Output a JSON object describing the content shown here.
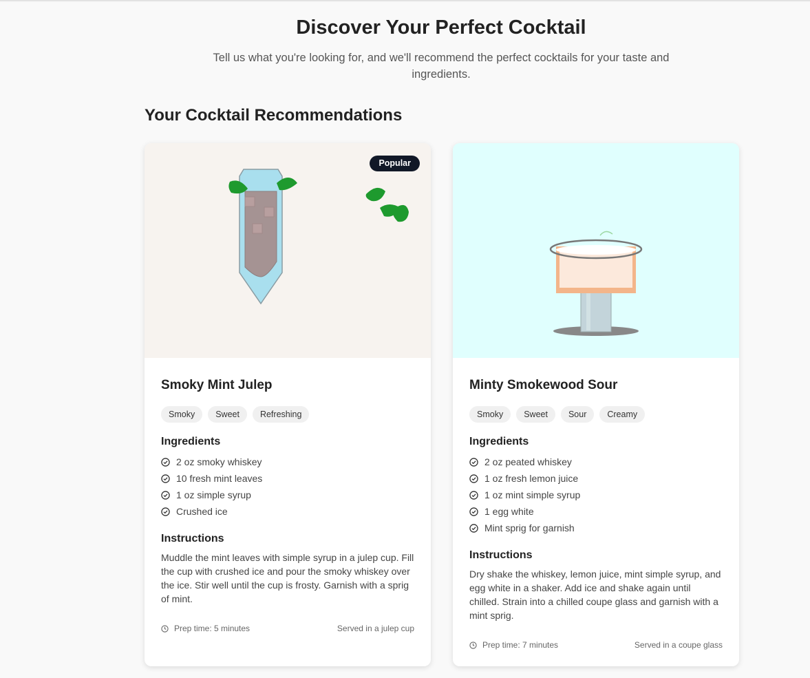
{
  "header": {
    "title": "Discover Your Perfect Cocktail",
    "subtitle": "Tell us what you're looking for, and we'll recommend the perfect cocktails for your taste and ingredients."
  },
  "section_title": "Your Cocktail Recommendations",
  "cards": [
    {
      "badge": "Popular",
      "title": "Smoky Mint Julep",
      "tags": [
        "Smoky",
        "Sweet",
        "Refreshing"
      ],
      "ingredients_heading": "Ingredients",
      "ingredients": [
        "2 oz smoky whiskey",
        "10 fresh mint leaves",
        "1 oz simple syrup",
        "Crushed ice"
      ],
      "instructions_heading": "Instructions",
      "instructions": "Muddle the mint leaves with simple syrup in a julep cup. Fill the cup with crushed ice and pour the smoky whiskey over the ice. Stir well until the cup is frosty. Garnish with a sprig of mint.",
      "prep_time": "Prep time: 5 minutes",
      "served_in": "Served in a julep cup",
      "image_bg": "#f7f3ef"
    },
    {
      "title": "Minty Smokewood Sour",
      "tags": [
        "Smoky",
        "Sweet",
        "Sour",
        "Creamy"
      ],
      "ingredients_heading": "Ingredients",
      "ingredients": [
        "2 oz peated whiskey",
        "1 oz fresh lemon juice",
        "1 oz mint simple syrup",
        "1 egg white",
        "Mint sprig for garnish"
      ],
      "instructions_heading": "Instructions",
      "instructions": "Dry shake the whiskey, lemon juice, mint simple syrup, and egg white in a shaker. Add ice and shake again until chilled. Strain into a chilled coupe glass and garnish with a mint sprig.",
      "prep_time": "Prep time: 7 minutes",
      "served_in": "Served in a coupe glass",
      "image_bg": "#e0fffe"
    }
  ],
  "icons": {
    "check": "check-circle-icon",
    "clock": "clock-icon"
  },
  "colors": {
    "badge_bg": "#111827",
    "mint": "#1e9a2e"
  }
}
